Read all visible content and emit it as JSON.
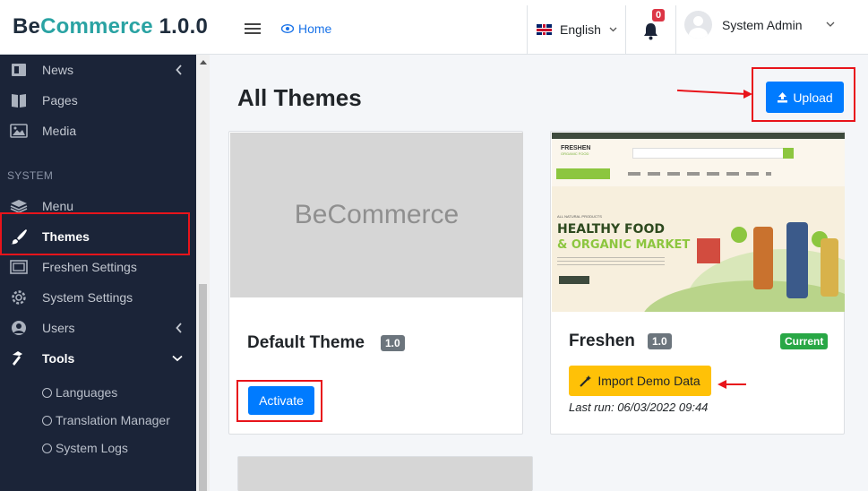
{
  "navbar": {
    "brand_be": "Be",
    "brand_commerce": "Commerce",
    "brand_version": "1.0.0",
    "home_label": "Home",
    "language_label": "English",
    "notification_count": "0",
    "user_name": "System Admin"
  },
  "sidebar": {
    "items": [
      {
        "label": "News",
        "icon": "newspaper-icon"
      },
      {
        "label": "Pages",
        "icon": "book-icon"
      },
      {
        "label": "Media",
        "icon": "image-icon"
      }
    ],
    "section_label": "SYSTEM",
    "system_items": [
      {
        "label": "Menu",
        "icon": "layers-icon"
      },
      {
        "label": "Themes",
        "icon": "paintbrush-icon"
      },
      {
        "label": "Freshen Settings",
        "icon": "window-icon"
      },
      {
        "label": "System Settings",
        "icon": "gear-icon"
      },
      {
        "label": "Users",
        "icon": "users-icon"
      },
      {
        "label": "Tools",
        "icon": "hammer-icon"
      }
    ],
    "tools_sub": [
      {
        "label": "Languages",
        "icon": "globe-icon"
      },
      {
        "label": "Translation Manager",
        "icon": "globe-icon"
      },
      {
        "label": "System Logs",
        "icon": "radiation-icon"
      }
    ]
  },
  "main": {
    "title": "All Themes",
    "upload_label": "Upload",
    "themes": [
      {
        "name": "Default Theme",
        "version": "1.0",
        "thumbnail_text": "BeCommerce",
        "action_label": "Activate"
      },
      {
        "name": "Freshen",
        "version": "1.0",
        "status": "Current",
        "import_label": "Import Demo Data",
        "last_run": "Last run: 06/03/2022 09:44"
      }
    ],
    "freshen_preview": {
      "headline1": "HEALTHY FOOD",
      "headline2": "& ORGANIC MARKET",
      "logo": "FRESHEN",
      "logo_sub": "ORGANIC FOOD",
      "small_text": "ALL NATURAL PRODUCTS"
    }
  },
  "colors": {
    "primary": "#007bff",
    "warning": "#ffc107",
    "success": "#28a745",
    "sidebar": "#1b2438",
    "annotation": "#e8141b"
  }
}
